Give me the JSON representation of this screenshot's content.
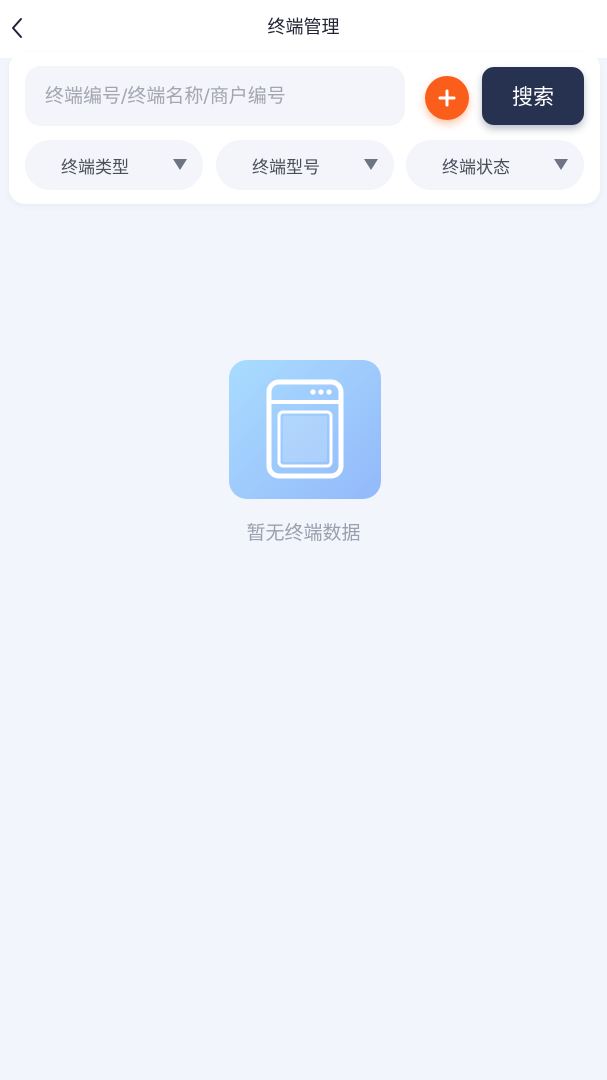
{
  "header": {
    "title": "终端管理",
    "back_icon": "chevron-left-icon"
  },
  "search": {
    "placeholder": "终端编号/终端名称/商户编号",
    "value": "",
    "add_icon": "plus-icon",
    "add_color": "#fb5e1a",
    "button_label": "搜索",
    "button_color": "#26324f"
  },
  "filters": [
    {
      "label": "终端类型",
      "icon": "caret-down-icon"
    },
    {
      "label": "终端型号",
      "icon": "caret-down-icon"
    },
    {
      "label": "终端状态",
      "icon": "caret-down-icon"
    }
  ],
  "empty_state": {
    "icon": "terminal-device-icon",
    "message": "暂无终端数据"
  }
}
